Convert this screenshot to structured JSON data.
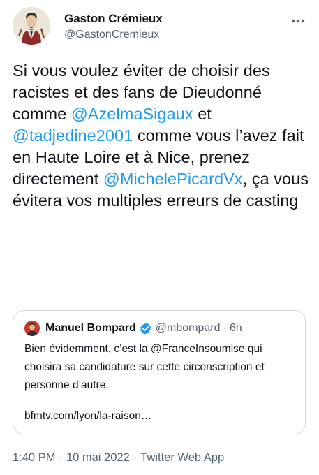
{
  "author": {
    "display_name": "Gaston Crémieux",
    "handle": "@GastonCremieux",
    "avatar_icon": "portrait-avatar-icon"
  },
  "tweet": {
    "segments": [
      {
        "text": "Si vous voulez éviter de choisir des racistes et des fans de Dieudonné comme ",
        "type": "text"
      },
      {
        "text": "@AzelmaSigaux",
        "type": "mention"
      },
      {
        "text": " et ",
        "type": "text"
      },
      {
        "text": "@tadjedine2001",
        "type": "mention"
      },
      {
        "text": " comme vous l’avez fait en Haute Loire et à Nice, prenez directement ",
        "type": "text"
      },
      {
        "text": "@MichelePicardVx",
        "type": "mention"
      },
      {
        "text": ", ça vous évitera vos multiples erreurs de casting",
        "type": "text"
      }
    ]
  },
  "quoted_tweet": {
    "display_name": "Manuel Bompard",
    "handle": "@mbompard",
    "separator": "·",
    "time": "6h",
    "verified": true,
    "text": "Bien évidemment, c’est la @FranceInsoumise qui choisira sa candidature sur cette circonscription et personne d’autre.",
    "link": "bfmtv.com/lyon/la-raison…"
  },
  "meta": {
    "time": "1:40 PM",
    "date": "10 mai 2022",
    "source": "Twitter Web App",
    "separator": "·"
  },
  "colors": {
    "mention": "#1d9bf0",
    "secondary_text": "#536471",
    "border": "#cfd9de",
    "verified_badge": "#1d9bf0"
  }
}
